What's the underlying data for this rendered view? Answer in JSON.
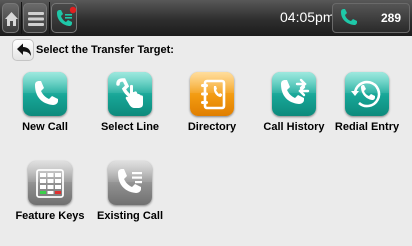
{
  "status_bar": {
    "home_icon": "home-icon",
    "menu_icon": "menu-icon",
    "call_indicator_icon": "phone-transfer-icon",
    "time": "04:05pm",
    "line_icon": "phone-icon",
    "extension": "289"
  },
  "prompt": {
    "back_icon": "back-arrow-icon",
    "text": "Select the Transfer Target:"
  },
  "targets": [
    {
      "label": "New Call",
      "icon": "phone-icon"
    },
    {
      "label": "Select Line",
      "icon": "phone-hand-icon"
    },
    {
      "label": "Directory",
      "icon": "directory-book-icon"
    },
    {
      "label": "Call History",
      "icon": "call-history-icon"
    },
    {
      "label": "Redial Entry",
      "icon": "redial-icon"
    },
    {
      "label": "Feature Keys",
      "icon": "keypad-icon"
    },
    {
      "label": "Existing Call",
      "icon": "phone-list-icon"
    }
  ],
  "colors": {
    "accent_teal": "#17a596",
    "accent_orange": "#f29a10",
    "status_bar": "#2e2e2e",
    "background": "#ebebeb"
  }
}
